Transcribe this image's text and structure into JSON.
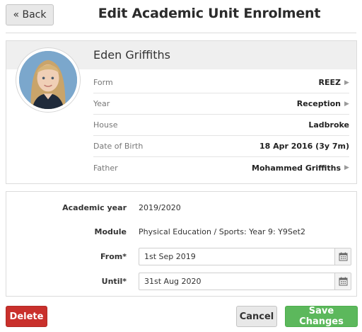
{
  "header": {
    "back_label": "« Back",
    "title": "Edit Academic Unit Enrolment"
  },
  "student": {
    "name": "Eden Griffiths",
    "avatar_icon": "student-photo",
    "details": [
      {
        "label": "Form",
        "value": "REEZ",
        "link": true
      },
      {
        "label": "Year",
        "value": "Reception",
        "link": true
      },
      {
        "label": "House",
        "value": "Ladbroke",
        "link": false
      },
      {
        "label": "Date of Birth",
        "value": "18 Apr 2016 (3y 7m)",
        "link": false
      },
      {
        "label": "Father",
        "value": "Mohammed Griffiths",
        "link": true
      }
    ]
  },
  "enrolment": {
    "academic_year_label": "Academic year",
    "academic_year_value": "2019/2020",
    "module_label": "Module",
    "module_value": "Physical Education / Sports: Year 9: Y9Set2",
    "from_label": "From*",
    "from_value": "1st Sep 2019",
    "until_label": "Until*",
    "until_value": "31st Aug 2020",
    "calendar_icon": "calendar-icon"
  },
  "actions": {
    "delete_label": "Delete",
    "cancel_label": "Cancel",
    "save_label": "Save Changes"
  },
  "colors": {
    "delete": "#c9302c",
    "save": "#5cb85c",
    "header_bg": "#efefef"
  }
}
